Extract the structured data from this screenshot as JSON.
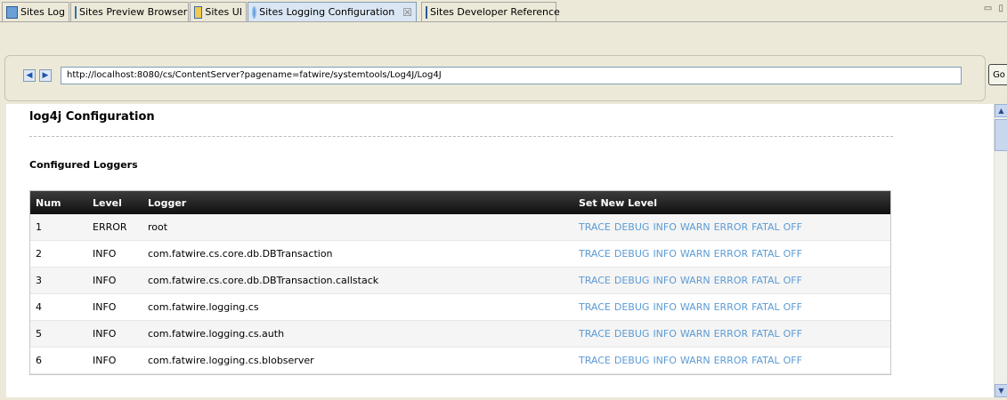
{
  "tabs": [
    {
      "label": "Sites Log",
      "icon": "log-icon"
    },
    {
      "label": "Sites Preview Browser",
      "icon": "browser-icon"
    },
    {
      "label": "Sites UI",
      "icon": "ui-icon"
    },
    {
      "label": "Sites Logging Configuration",
      "icon": "gear-icon",
      "active": true,
      "close": "☒"
    },
    {
      "label": "Sites Developer Reference",
      "icon": "book-icon"
    }
  ],
  "window_controls": "▭ ▯",
  "nav": {
    "back": "◀",
    "forward": "▶",
    "url": "http://localhost:8080/cs/ContentServer?pagename=fatwire/systemtools/Log4J/Log4J",
    "go_label": "Go"
  },
  "page": {
    "title": "log4j Configuration",
    "subtitle": "Configured Loggers"
  },
  "table": {
    "headers": {
      "num": "Num",
      "level": "Level",
      "logger": "Logger",
      "set": "Set New Level"
    },
    "levels": [
      "TRACE",
      "DEBUG",
      "INFO",
      "WARN",
      "ERROR",
      "FATAL",
      "OFF"
    ],
    "rows": [
      {
        "num": "1",
        "level": "ERROR",
        "logger": "root"
      },
      {
        "num": "2",
        "level": "INFO",
        "logger": "com.fatwire.cs.core.db.DBTransaction"
      },
      {
        "num": "3",
        "level": "INFO",
        "logger": "com.fatwire.cs.core.db.DBTransaction.callstack"
      },
      {
        "num": "4",
        "level": "INFO",
        "logger": "com.fatwire.logging.cs"
      },
      {
        "num": "5",
        "level": "INFO",
        "logger": "com.fatwire.logging.cs.auth"
      },
      {
        "num": "6",
        "level": "INFO",
        "logger": "com.fatwire.logging.cs.blobserver"
      }
    ]
  },
  "colors": {
    "link": "#5b9bd5",
    "header_bg": "#1e1e1e",
    "accent": "#7f9db9"
  }
}
